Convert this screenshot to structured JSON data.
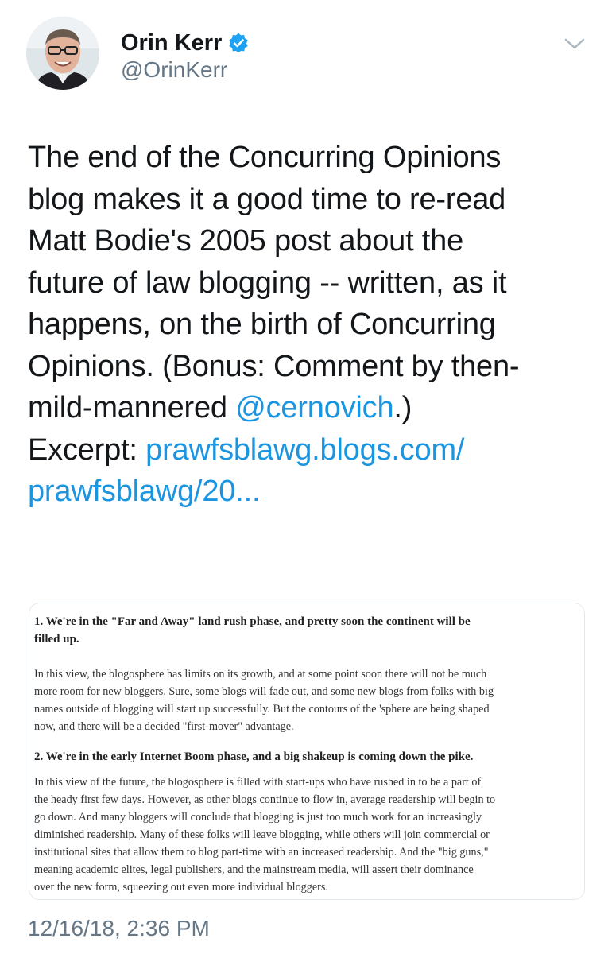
{
  "author": {
    "name": "Orin Kerr",
    "handle": "@OrinKerr",
    "verified_icon": "verified-badge-icon",
    "avatar_icon": "avatar-photo",
    "menu_icon": "chevron-down-icon"
  },
  "tweet": {
    "lines": [
      "The end of the Concurring Opinions",
      "blog makes it a good time to re-read",
      "Matt Bodie's 2005 post about the",
      "future of law blogging -- written, as it",
      "happens, on the birth of Concurring",
      "Opinions.  (Bonus: Comment by then-"
    ],
    "line7_prefix": "mild-mannered ",
    "mention": "@cernovich",
    "line7_suffix": ".)",
    "excerpt_label": "Excerpt:  ",
    "link_part1": "prawfsblawg.blogs.com/",
    "link_part2": "prawfsblawg/20..."
  },
  "card": {
    "heading1_lines": [
      "1. We're in the \"Far and Away\" land rush phase, and pretty soon the continent will be",
      "filled up."
    ],
    "para1_lines": [
      "In this view, the blogosphere has limits on its growth, and at some point soon there will not be much",
      "more room for new bloggers.  Sure, some blogs will fade out, and some new blogs from folks with big",
      "names outside of blogging will start up successfully.  But the contours of the 'sphere are being shaped",
      "now, and there will be a decided \"first-mover\" advantage."
    ],
    "heading2": "2. We're in the early Internet Boom phase, and a big shakeup is coming down the pike.",
    "para2_lines": [
      "In this view of the future, the blogosphere is filled with start-ups who have rushed in to be a part of",
      "the heady first few days.  However, as other blogs continue to flow in, average readership will begin to",
      "go down.  And many bloggers will conclude that blogging is just too much work for an increasingly",
      "diminished readership.  Many of these folks will leave blogging, while others will join commercial or",
      "institutional sites that allow them to blog part-time with an increased readership.  And the \"big guns,\"",
      "meaning academic elites, legal publishers, and the mainstream media, will assert their dominance",
      "over the new form, squeezing out even more individual bloggers."
    ]
  },
  "timestamp": "12/16/18, 2:36 PM",
  "colors": {
    "link": "#1b95e0",
    "verified": "#1da1f2",
    "secondary_text": "#657786"
  }
}
